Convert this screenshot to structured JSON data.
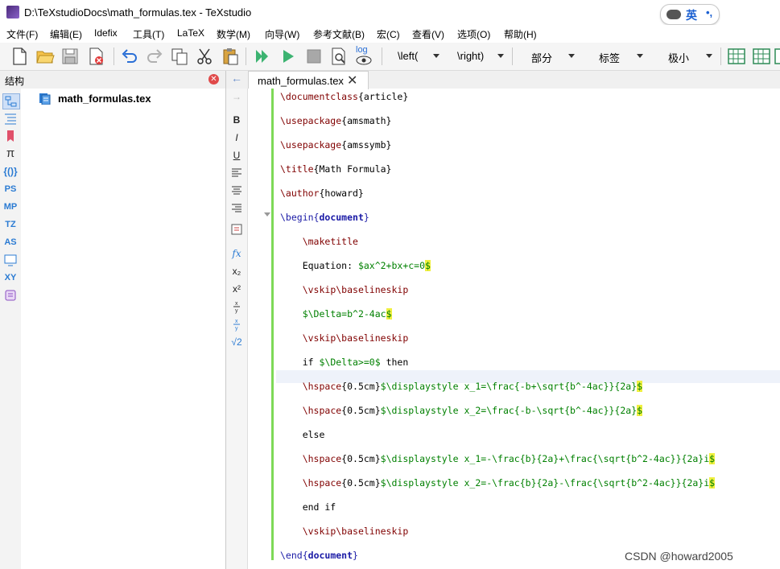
{
  "window": {
    "title": "D:\\TeXstudioDocs\\math_formulas.tex - TeXstudio"
  },
  "ime": {
    "lang": "英",
    "dots": "•,"
  },
  "menu": [
    "文件(F)",
    "编辑(E)",
    "Idefix",
    "工具(T)",
    "LaTeX",
    "数学(M)",
    "向导(W)",
    "参考文献(B)",
    "宏(C)",
    "查看(V)",
    "选项(O)",
    "帮助(H)"
  ],
  "toolbar": {
    "combos": [
      "\\left(",
      "\\right)",
      "部分",
      "标签",
      "极小"
    ],
    "log_label": "log"
  },
  "structure": {
    "title": "结构",
    "file": "math_formulas.tex"
  },
  "side_icons": [
    "PS",
    "MP",
    "TZ",
    "AS",
    "XY"
  ],
  "palette": [
    "B",
    "I",
    "U",
    "fx",
    "x₂",
    "x²",
    "√2"
  ],
  "tab": {
    "label": "math_formulas.tex"
  },
  "code_lines": [
    "\\documentclass{article}",
    "\\usepackage{amsmath}",
    "\\usepackage{amssymb}",
    "\\title{Math Formula}",
    "\\author{howard}",
    "\\begin{document}",
    "    \\maketitle",
    "    Equation: $ax^2+bx+c=0$",
    "    \\vskip\\baselineskip",
    "    $\\Delta=b^2-4ac$",
    "    \\vskip\\baselineskip",
    "    if $\\Delta>=0$ then",
    "    \\hspace{0.5cm}$\\displaystyle x_1=\\frac{-b+\\sqrt{b^-4ac}}{2a}$",
    "    \\hspace{0.5cm}$\\displaystyle x_2=\\frac{-b-\\sqrt{b^-4ac}}{2a}$",
    "    else",
    "    \\hspace{0.5cm}$\\displaystyle x_1=-\\frac{b}{2a}+\\frac{\\sqrt{b^2-4ac}}{2a}i$",
    "    \\hspace{0.5cm}$\\displaystyle x_2=-\\frac{b}{2a}-\\frac{\\sqrt{b^2-4ac}}{2a}i$",
    "    end if",
    "    \\vskip\\baselineskip",
    "\\end{document}"
  ],
  "watermark": "CSDN @howard2005",
  "colors": {
    "command": "#800000",
    "keyword": "#1a1aa6",
    "math": "#008000",
    "changebar": "#7ed957"
  }
}
